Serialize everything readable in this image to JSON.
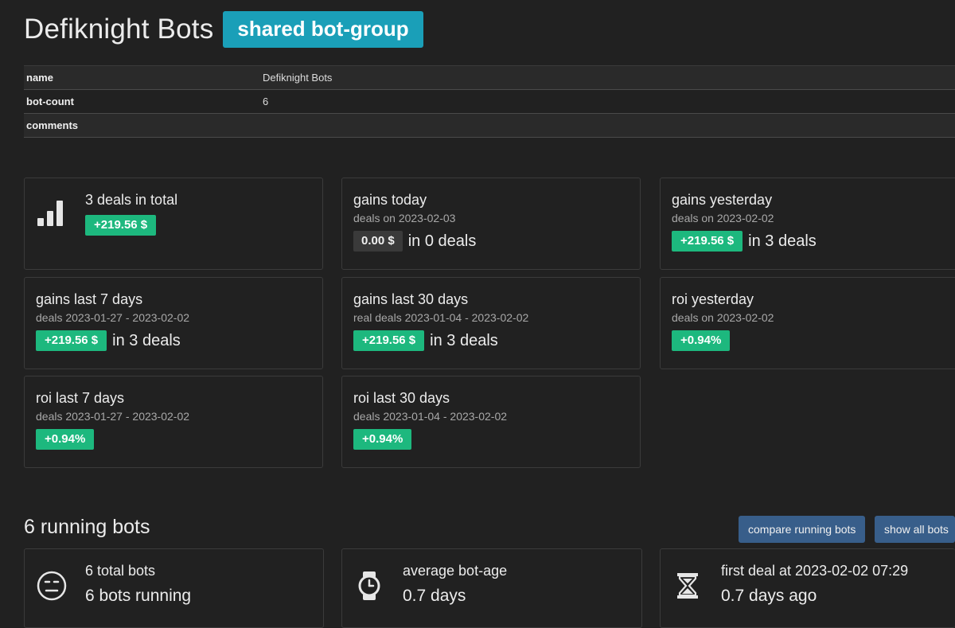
{
  "header": {
    "title": "Defiknight Bots",
    "badge": "shared bot-group"
  },
  "info": [
    {
      "key": "name",
      "value": "Defiknight Bots"
    },
    {
      "key": "bot-count",
      "value": "6"
    },
    {
      "key": "comments",
      "value": ""
    }
  ],
  "stats": {
    "total": {
      "title": "3 deals in total",
      "amount": "+219.56 $"
    },
    "today": {
      "title": "gains today",
      "sub": "deals on 2023-02-03",
      "amount": "0.00 $",
      "deals": "in 0 deals"
    },
    "yesterday": {
      "title": "gains yesterday",
      "sub": "deals on 2023-02-02",
      "amount": "+219.56 $",
      "deals": "in 3 deals"
    },
    "last7": {
      "title": "gains last 7 days",
      "sub": "deals 2023-01-27 - 2023-02-02",
      "amount": "+219.56 $",
      "deals": "in 3 deals"
    },
    "last30": {
      "title": "gains last 30 days",
      "sub": "real deals 2023-01-04 - 2023-02-02",
      "amount": "+219.56 $",
      "deals": "in 3 deals"
    },
    "roi_yesterday": {
      "title": "roi yesterday",
      "sub": "deals on 2023-02-02",
      "amount": "+0.94%"
    },
    "roi7": {
      "title": "roi last 7 days",
      "sub": "deals 2023-01-27 - 2023-02-02",
      "amount": "+0.94%"
    },
    "roi30": {
      "title": "roi last 30 days",
      "sub": "deals 2023-01-04 - 2023-02-02",
      "amount": "+0.94%"
    }
  },
  "running": {
    "title": "6 running bots",
    "compare_label": "compare running bots",
    "show_all_label": "show all bots",
    "cards": [
      {
        "line1": "6 total bots",
        "line2": "6 bots running",
        "icon": "neutral-face-icon"
      },
      {
        "line1": "average bot-age",
        "line2": "0.7 days",
        "icon": "watch-icon"
      },
      {
        "line1": "first deal at 2023-02-02 07:29",
        "line2": "0.7 days ago",
        "icon": "hourglass-icon"
      }
    ]
  },
  "colors": {
    "accent": "#1a9fb8",
    "gain": "#1db87e",
    "button": "#385e8a",
    "background": "#212121"
  }
}
